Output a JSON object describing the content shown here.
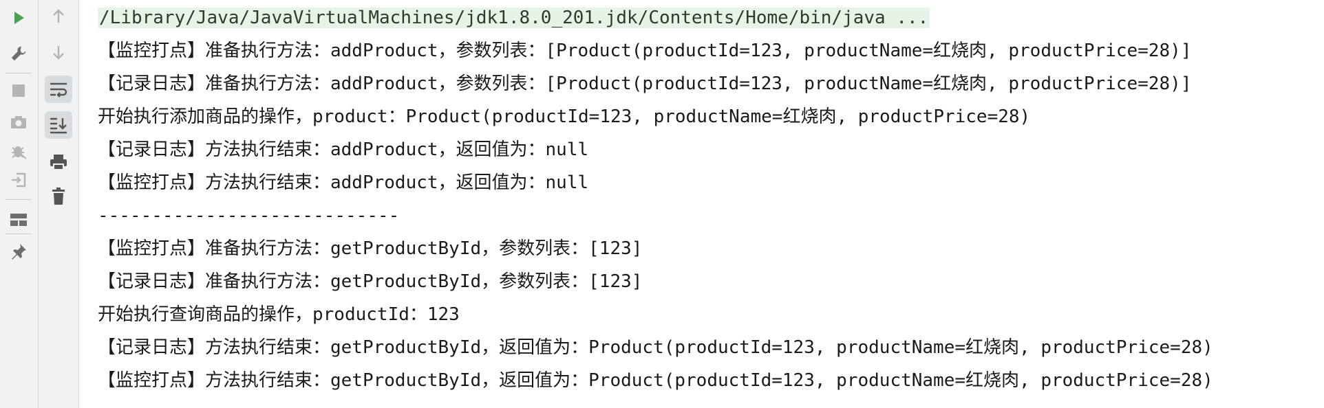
{
  "toolbar": {
    "left_icons": [
      "run-icon",
      "wrench-icon",
      "stop-icon",
      "camera-icon",
      "debug-icon",
      "exit-icon",
      "layout-icon",
      "pin-icon"
    ],
    "right_icons": [
      "arrow-up-icon",
      "arrow-down-icon",
      "soft-wrap-icon",
      "scroll-to-end-icon",
      "print-icon",
      "trash-icon"
    ],
    "colors": {
      "run": "#4aa04e",
      "icon": "#6e6e6e",
      "disabled": "#b5b5b5",
      "active_bg": "#d9dcde",
      "command_bg": "#e6f4e7"
    }
  },
  "console": {
    "command": "/Library/Java/JavaVirtualMachines/jdk1.8.0_201.jdk/Contents/Home/bin/java ...",
    "lines": [
      "【监控打点】准备执行方法：addProduct，参数列表：[Product(productId=123, productName=红烧肉, productPrice=28)]",
      "【记录日志】准备执行方法：addProduct，参数列表：[Product(productId=123, productName=红烧肉, productPrice=28)]",
      "开始执行添加商品的操作，product：Product(productId=123, productName=红烧肉, productPrice=28)",
      "【记录日志】方法执行结束：addProduct，返回值为：null",
      "【监控打点】方法执行结束：addProduct，返回值为：null",
      "----------------------------",
      "【监控打点】准备执行方法：getProductById，参数列表：[123]",
      "【记录日志】准备执行方法：getProductById，参数列表：[123]",
      "开始执行查询商品的操作，productId：123",
      "【记录日志】方法执行结束：getProductById，返回值为：Product(productId=123, productName=红烧肉, productPrice=28)",
      "【监控打点】方法执行结束：getProductById，返回值为：Product(productId=123, productName=红烧肉, productPrice=28)"
    ]
  }
}
